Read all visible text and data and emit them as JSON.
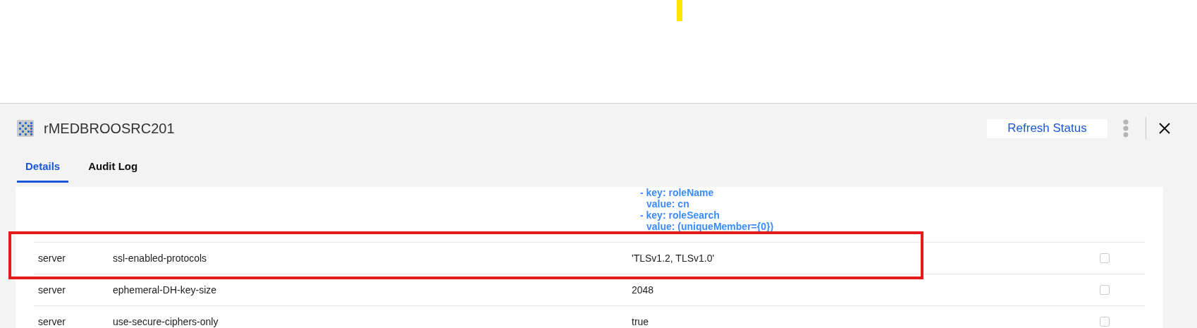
{
  "header": {
    "title": "rMEDBROOSRC201",
    "refresh_button": "Refresh Status"
  },
  "tabs": [
    {
      "label": "Details",
      "selected": true
    },
    {
      "label": "Audit Log",
      "selected": false
    }
  ],
  "yaml_lines": [
    {
      "text": "- key: roleName",
      "kind": "key"
    },
    {
      "text": "value: cn",
      "kind": "value"
    },
    {
      "text": "- key: roleSearch",
      "kind": "key"
    },
    {
      "text": "value: (uniqueMember={0})",
      "kind": "value"
    }
  ],
  "rows": [
    {
      "section": "server",
      "property": "ssl-enabled-protocols",
      "value": "'TLSv1.2, TLSv1.0'",
      "checked": false
    },
    {
      "section": "server",
      "property": "ephemeral-DH-key-size",
      "value": "2048",
      "checked": false
    },
    {
      "section": "server",
      "property": "use-secure-ciphers-only",
      "value": "true",
      "checked": false
    }
  ]
}
